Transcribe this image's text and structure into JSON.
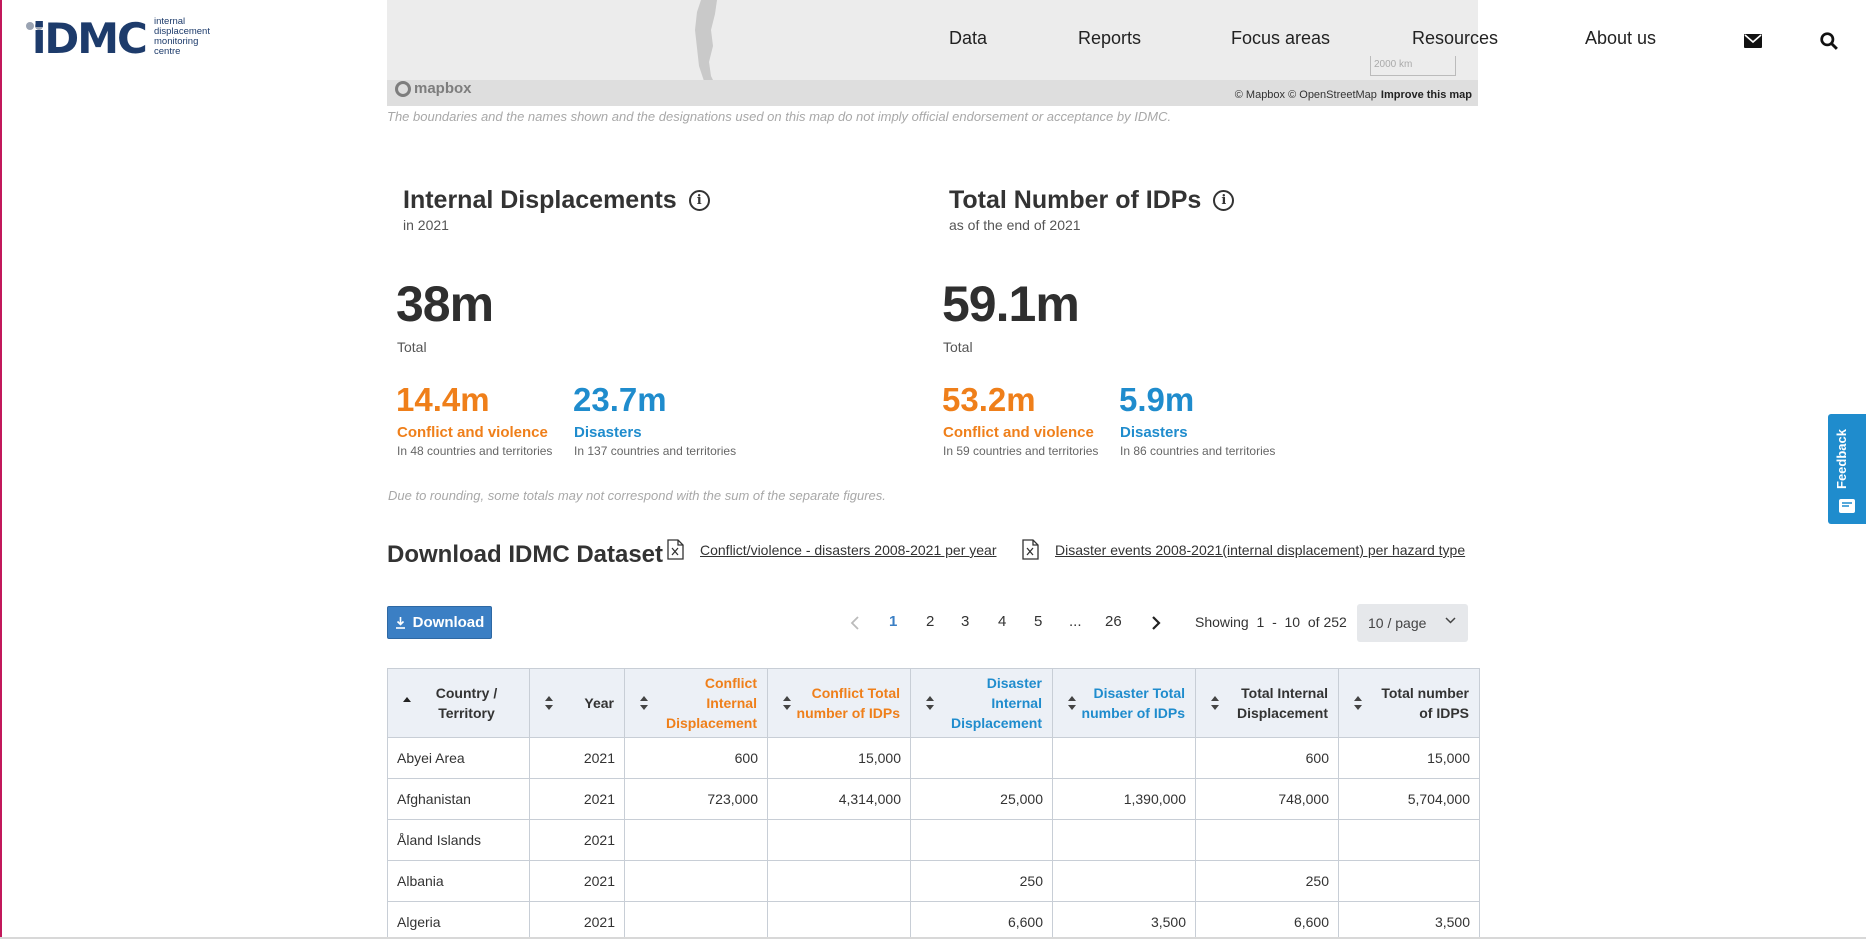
{
  "header": {
    "logo_text": "iDMC",
    "logo_subtitle": [
      "internal",
      "displacement",
      "monitoring",
      "centre"
    ],
    "nav": [
      "Data",
      "Reports",
      "Focus areas",
      "Resources",
      "About us"
    ],
    "icons": [
      "envelope-icon",
      "search-icon"
    ]
  },
  "map": {
    "brand": "mapbox",
    "attribution": "© Mapbox © OpenStreetMap",
    "improve_link": "Improve this map",
    "scale_label": "2000 km",
    "disclaimer": "The boundaries and the names shown and the designations used on this map do not imply official endorsement or acceptance by IDMC."
  },
  "internal_displacements": {
    "title": "Internal Displacements",
    "subtitle": "in 2021",
    "total": "38m",
    "total_label": "Total",
    "conflict_value": "14.4m",
    "conflict_label": "Conflict and violence",
    "conflict_desc": "In 48 countries and territories",
    "disaster_value": "23.7m",
    "disaster_label": "Disasters",
    "disaster_desc": "In 137 countries and territories"
  },
  "total_idps": {
    "title": "Total Number of IDPs",
    "subtitle": "as of the end of 2021",
    "total": "59.1m",
    "total_label": "Total",
    "conflict_value": "53.2m",
    "conflict_label": "Conflict and violence",
    "conflict_desc": "In 59 countries and territories",
    "disaster_value": "5.9m",
    "disaster_label": "Disasters",
    "disaster_desc": "In 86 countries and territories"
  },
  "rounding_note": "Due to rounding, some totals may not correspond with the sum of the separate figures.",
  "download": {
    "heading": "Download IDMC Dataset",
    "link1": "Conflict/violence - disasters 2008-2021 per year",
    "link2": "Disaster events 2008-2021(internal displacement) per hazard type",
    "button_label": "Download"
  },
  "pagination": {
    "pages": [
      "1",
      "2",
      "3",
      "4",
      "5",
      "...",
      "26"
    ],
    "active": "1",
    "showing_prefix": "Showing",
    "range_start": "1",
    "range_sep": "-",
    "range_end": "10",
    "of_total": "of 252",
    "page_size": "10 / page"
  },
  "colors": {
    "conflict": "#ef7f1a",
    "disaster": "#1f8ccd",
    "brand": "#1d3b6b",
    "button": "#3b7fc4"
  },
  "table": {
    "headers": [
      {
        "label": "Country / Territory",
        "color": "default"
      },
      {
        "label": "Year",
        "color": "default"
      },
      {
        "label": "Conflict Internal Displacement",
        "color": "orange"
      },
      {
        "label": "Conflict Total number of IDPs",
        "color": "orange"
      },
      {
        "label": "Disaster Internal Displacement",
        "color": "blue"
      },
      {
        "label": "Disaster Total number of IDPs",
        "color": "blue"
      },
      {
        "label": "Total Internal Displacement",
        "color": "default"
      },
      {
        "label": "Total number of IDPS",
        "color": "default"
      }
    ],
    "rows": [
      [
        "Abyei Area",
        "2021",
        "600",
        "15,000",
        "",
        "",
        "600",
        "15,000"
      ],
      [
        "Afghanistan",
        "2021",
        "723,000",
        "4,314,000",
        "25,000",
        "1,390,000",
        "748,000",
        "5,704,000"
      ],
      [
        "Åland Islands",
        "2021",
        "",
        "",
        "",
        "",
        "",
        ""
      ],
      [
        "Albania",
        "2021",
        "",
        "",
        "250",
        "",
        "250",
        ""
      ],
      [
        "Algeria",
        "2021",
        "",
        "",
        "6,600",
        "3,500",
        "6,600",
        "3,500"
      ]
    ]
  },
  "feedback": {
    "label": "Feedback"
  }
}
